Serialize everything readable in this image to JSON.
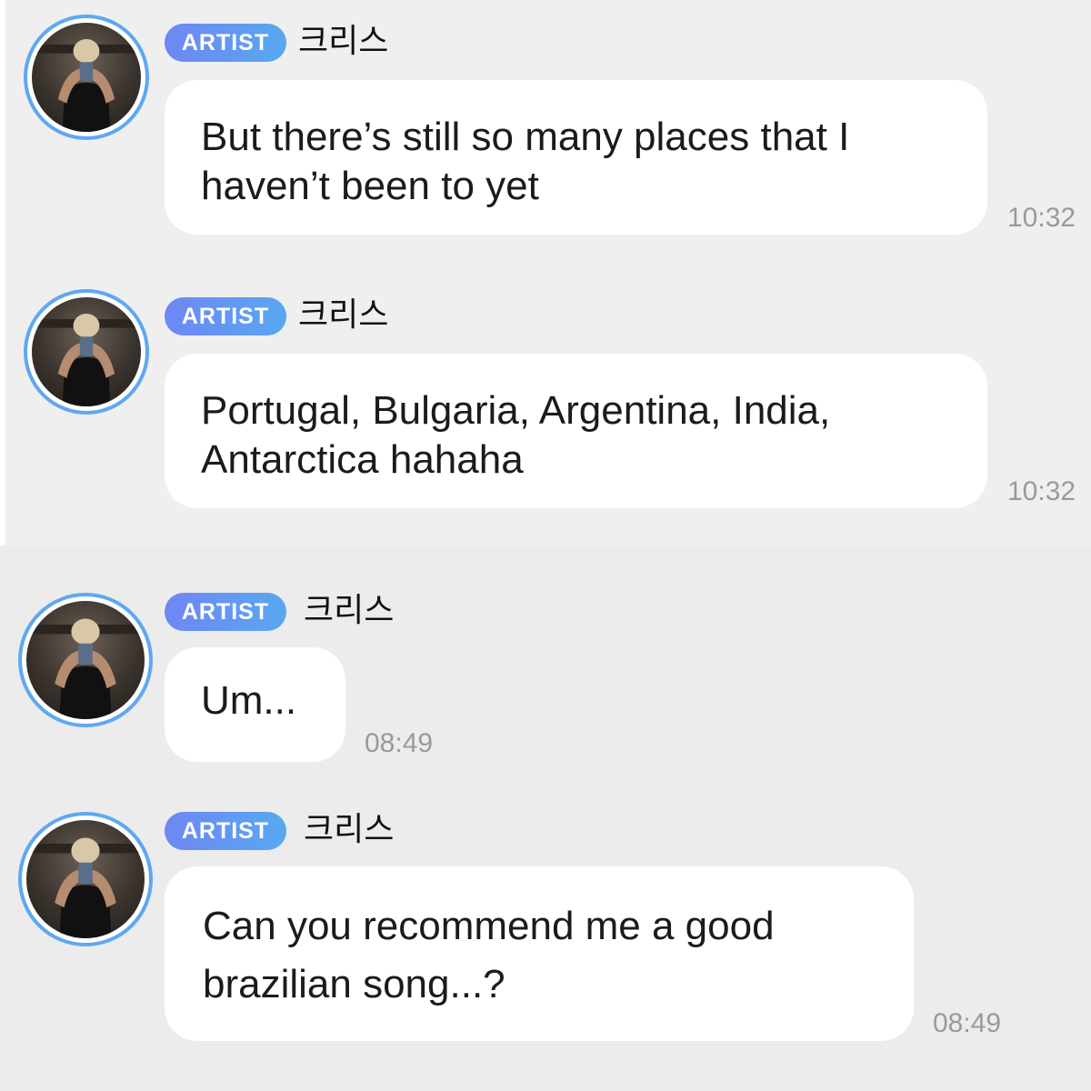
{
  "messages": [
    {
      "badge": "ARTIST",
      "sender": "크리스",
      "lines": [
        "But there’s still so many places that I",
        "haven’t been to yet"
      ],
      "time": "10:32"
    },
    {
      "badge": "ARTIST",
      "sender": "크리스",
      "lines": [
        "Portugal, Bulgaria, Argentina, India,",
        "Antarctica hahaha"
      ],
      "time": "10:32"
    },
    {
      "badge": "ARTIST",
      "sender": "크리스",
      "lines": [
        "Um..."
      ],
      "time": "08:49"
    },
    {
      "badge": "ARTIST",
      "sender": "크리스",
      "lines": [
        "Can you recommend me a good",
        "brazilian song...?"
      ],
      "time": "08:49"
    }
  ],
  "colors": {
    "background": "#efefef",
    "bubble": "#ffffff",
    "badge_start": "#6f86f4",
    "badge_end": "#58a8f0",
    "avatar_ring": "#5ea8f2",
    "timestamp": "#9a9a9a"
  },
  "icons": {
    "avatar": "profile-photo"
  }
}
